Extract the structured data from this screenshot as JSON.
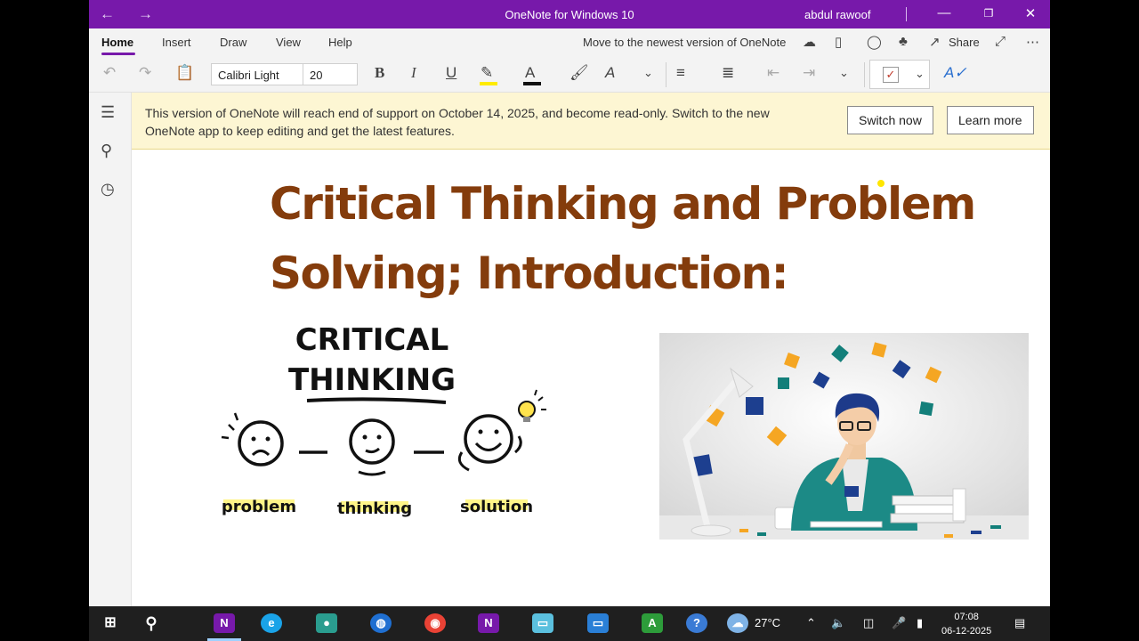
{
  "window": {
    "title": "OneNote for Windows 10",
    "user": "abdul rawoof",
    "back_icon": "←",
    "forward_icon": "→",
    "minimize_icon": "—",
    "maximize_icon": "❐",
    "close_icon": "✕"
  },
  "menu": {
    "tabs": [
      "Home",
      "Insert",
      "Draw",
      "View",
      "Help"
    ],
    "move_text": "Move to the newest version of OneNote",
    "share_label": "Share"
  },
  "toolbar": {
    "font_name": "Calibri Light",
    "font_size": "20",
    "bold": "B",
    "italic": "I",
    "underline": "U",
    "font_color_letter": "A",
    "style_letter": "A",
    "highlight_color": "#ffeb00",
    "font_color": "#111111"
  },
  "banner": {
    "message": "This version of OneNote will reach end of support on October 14, 2025, and become read-only. Switch to the new OneNote app to keep editing and get the latest features.",
    "switch_label": "Switch now",
    "learn_label": "Learn more"
  },
  "page": {
    "title_line1": "Critical Thinking and Problem",
    "title_line2": "Solving; Introduction:",
    "title_color": "#843c0c"
  },
  "sketch": {
    "heading_line1": "CRITICAL",
    "heading_line2": "THINKING",
    "labels": [
      "problem",
      "thinking",
      "solution"
    ]
  },
  "taskbar": {
    "weather": "27°C",
    "time": "07:08",
    "date": "06-12-2025"
  }
}
